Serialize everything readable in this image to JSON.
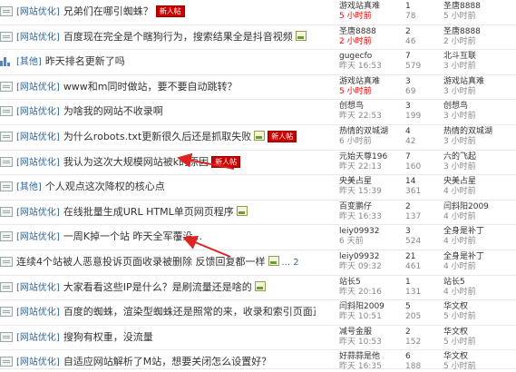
{
  "rows": [
    {
      "icon": "doc",
      "cat": "[网站优化]",
      "title": "兄弟们在哪引蜘蛛？",
      "badge": "新人帖",
      "img": false,
      "pages": "",
      "author": "游戏站真难",
      "created": "5 小时前",
      "created_red": true,
      "replies": "1",
      "views": "78",
      "last_author": "圣唐8888",
      "last_time": "5 小时前"
    },
    {
      "icon": "doc",
      "cat": "[网站优化]",
      "title": "百度现在完全是个瞎狗行为，搜索结果全是抖音视频",
      "badge": "",
      "img": true,
      "pages": "",
      "author": "圣唐8888",
      "created": "2 小时前",
      "created_red": true,
      "replies": "2",
      "views": "46",
      "last_author": "圣唐8888",
      "last_time": "2 小时前"
    },
    {
      "icon": "bars",
      "cat": "[其他]",
      "title": "昨天排名更新了吗",
      "badge": "",
      "img": false,
      "pages": "",
      "author": "gugecfo",
      "created": "昨天 16:53",
      "created_red": false,
      "replies": "7",
      "views": "579",
      "last_author": "北斗互联",
      "last_time": "3 小时前"
    },
    {
      "icon": "doc",
      "cat": "[网站优化]",
      "title": "www和m同时做站，要不要自动跳转？",
      "badge": "",
      "img": false,
      "pages": "",
      "author": "游戏站真难",
      "created": "5 小时前",
      "created_red": true,
      "replies": "3",
      "views": "69",
      "last_author": "游戏站真难",
      "last_time": "3 小时前"
    },
    {
      "icon": "doc",
      "cat": "[网站优化]",
      "title": "为啥我的网站不收录啊",
      "badge": "",
      "img": false,
      "pages": "",
      "author": "创想鸟",
      "created": "昨天 22:53",
      "created_red": false,
      "replies": "3",
      "views": "199",
      "last_author": "创想鸟",
      "last_time": "3 小时前"
    },
    {
      "icon": "doc",
      "cat": "[网站优化]",
      "title": "为什么robots.txt更新很久后还是抓取失败",
      "badge": "新人帖",
      "img": true,
      "pages": "",
      "author": "热情的双城湖",
      "created": "6 小时前",
      "created_red": false,
      "replies": "4",
      "views": "42",
      "last_author": "热情的双城湖",
      "last_time": "3 小时前"
    },
    {
      "icon": "doc",
      "cat": "[网站优化]",
      "title": "我认为这次大规模网站被k的原因",
      "badge": "新人帖",
      "img": false,
      "pages": "",
      "author": "元始天尊196",
      "created": "昨天 22:13",
      "created_red": false,
      "replies": "7",
      "views": "160",
      "last_author": "六的飞起",
      "last_time": "3 小时前"
    },
    {
      "icon": "doc",
      "cat": "[其他]",
      "title": "个人观点这次降权的核心点",
      "badge": "",
      "img": false,
      "pages": "",
      "author": "央美占星",
      "created": "昨天 15:39",
      "created_red": false,
      "replies": "14",
      "views": "361",
      "last_author": "央美占星",
      "last_time": "4 小时前"
    },
    {
      "icon": "doc",
      "cat": "[网站优化]",
      "title": "在线批量生成URL HTML单页网页程序",
      "badge": "",
      "img": true,
      "pages": "",
      "author": "百变鹏仔",
      "created": "昨天 16:33",
      "created_red": false,
      "replies": "2",
      "views": "137",
      "last_author": "闫斜阳2009",
      "last_time": "4 小时前"
    },
    {
      "icon": "doc",
      "cat": "[网站优化]",
      "title": "一周K掉一个站 昨天全军覆没...",
      "badge": "",
      "img": false,
      "pages": "",
      "author": "leiy09932",
      "created": "6 天前",
      "created_red": false,
      "replies": "3",
      "views": "524",
      "last_author": "全身是补丁",
      "last_time": "4 小时前"
    },
    {
      "icon": "doc",
      "cat": "",
      "title": "连续4个站被人恶意投诉页面收录被删除 反馈回复都一样",
      "badge": "",
      "img": true,
      "pages": "... 2",
      "author": "leiy09932",
      "created": "昨天 09:32",
      "created_red": false,
      "replies": "21",
      "views": "461",
      "last_author": "全身是补丁",
      "last_time": "4 小时前"
    },
    {
      "icon": "doc",
      "cat": "[网站优化]",
      "title": "大家看看这些IP是什么？是刷流量还是啥的",
      "badge": "",
      "img": true,
      "pages": "",
      "author": "站长5",
      "created": "昨天 20:16",
      "created_red": false,
      "replies": "1",
      "views": "131",
      "last_author": "站长5",
      "last_time": "4 小时前"
    },
    {
      "icon": "doc",
      "cat": "[网站优化]",
      "title": "百度的蜘蛛，渲染型蜘蛛还是照常的来，收录和索引页面正常",
      "badge": "",
      "img": false,
      "pages": "",
      "author": "闫斜阳2009",
      "created": "昨天 10:51",
      "created_red": false,
      "replies": "5",
      "views": "205",
      "last_author": "华文权",
      "last_time": "5 小时前"
    },
    {
      "icon": "doc",
      "cat": "[网站优化]",
      "title": "搜狗有权重，没流量",
      "badge": "",
      "img": false,
      "pages": "",
      "author": "减号金服",
      "created": "昨天 10:53",
      "created_red": false,
      "replies": "2",
      "views": "152",
      "last_author": "华文权",
      "last_time": "5 小时前"
    },
    {
      "icon": "doc",
      "cat": "[网站优化]",
      "title": "自适应网站解析了M站，想要关闭怎么设置好？",
      "badge": "",
      "img": false,
      "pages": "",
      "author": "好蒜蒜是他",
      "created": "昨天 16:35",
      "created_red": false,
      "replies": "6",
      "views": "188",
      "last_author": "华文权",
      "last_time": "5 小时前"
    }
  ],
  "colors": {
    "category": "#336699",
    "badge_bg": "#cc0000",
    "arrow": "#dd2222"
  }
}
